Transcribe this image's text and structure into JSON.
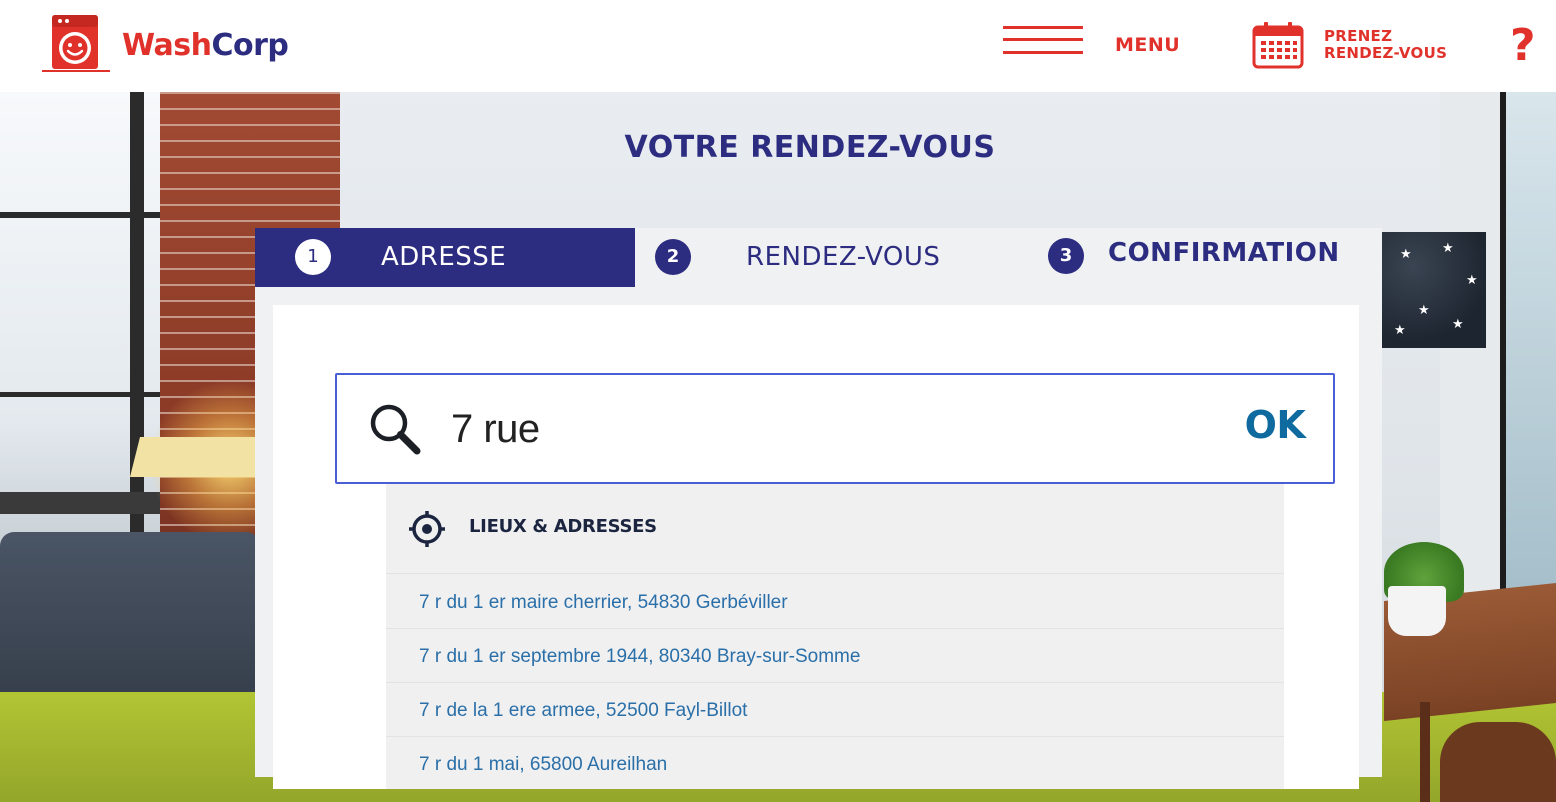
{
  "header": {
    "logo_part1": "Wash",
    "logo_part2": "Corp",
    "menu_label": "MENU",
    "appointment_line1": "PRENEZ",
    "appointment_line2": "RENDEZ-VOUS",
    "help_label": "?"
  },
  "page": {
    "title": "VOTRE RENDEZ-VOUS"
  },
  "steps": [
    {
      "number": "1",
      "label": "ADRESSE",
      "active": true
    },
    {
      "number": "2",
      "label": "RENDEZ-VOUS",
      "active": false
    },
    {
      "number": "3",
      "label": "CONFIRMATION",
      "active": false
    }
  ],
  "search": {
    "value": "7 rue",
    "ok_label": "OK"
  },
  "dropdown": {
    "title": "LIEUX & ADRESSES",
    "suggestions": [
      "7 r du 1 er maire cherrier, 54830 Gerbéviller",
      "7 r du 1 er septembre 1944, 80340 Bray-sur-Somme",
      "7 r de la 1 ere armee, 52500 Fayl-Billot",
      "7 r du 1 mai, 65800 Aureilhan"
    ]
  },
  "colors": {
    "brand_red": "#e0322b",
    "brand_navy": "#2c2c80",
    "link_blue": "#2a6fa8",
    "ok_blue": "#0f6aa0"
  },
  "icons": {
    "logo": "washing-machine-icon",
    "menu": "hamburger-icon",
    "appointment": "calendar-icon",
    "search": "search-icon",
    "location": "target-icon"
  }
}
